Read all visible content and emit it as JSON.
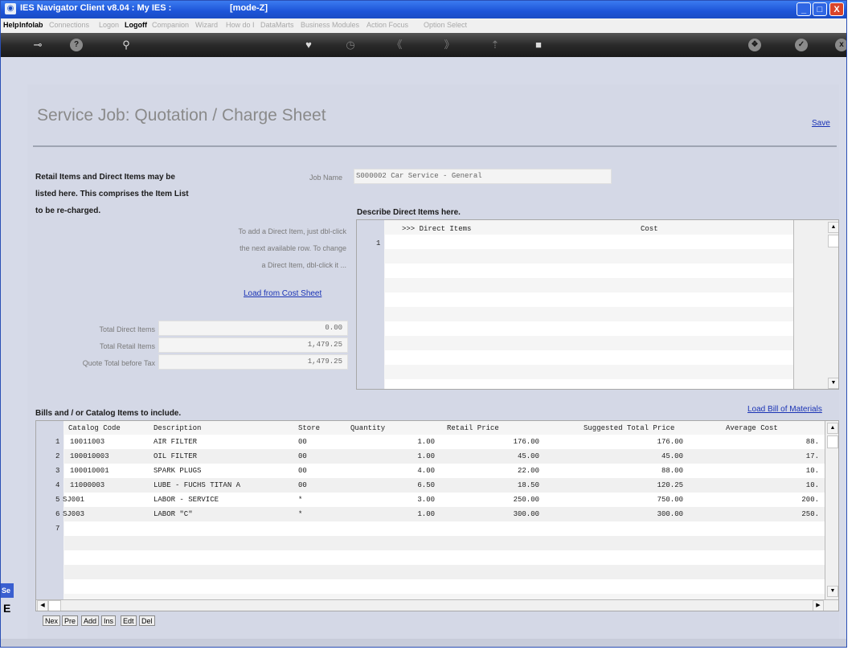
{
  "window": {
    "title": "IES Navigator Client v8.04 : My IES :",
    "mode": "[mode-Z]",
    "minimize_label": "_",
    "maximize_label": "□",
    "close_label": "X"
  },
  "menu": {
    "items": [
      {
        "label": "Help",
        "enabled": true
      },
      {
        "label": "Infolab",
        "enabled": true
      },
      {
        "label": "Connections",
        "enabled": false
      },
      {
        "label": "Logon",
        "enabled": false
      },
      {
        "label": "Logoff",
        "enabled": true
      },
      {
        "label": "Companion",
        "enabled": false
      },
      {
        "label": "Wizard",
        "enabled": false
      },
      {
        "label": "How do I",
        "enabled": false
      },
      {
        "label": "DataMarts",
        "enabled": false
      },
      {
        "label": "Business Modules",
        "enabled": false
      },
      {
        "label": "Action Focus",
        "enabled": false
      },
      {
        "label": "Option Select",
        "enabled": false
      }
    ]
  },
  "toolbar": {
    "icons": [
      "key-icon",
      "help-icon",
      "search-icon",
      "heart-icon",
      "clock-icon",
      "back-icon",
      "forward-icon",
      "up-icon",
      "stop-icon",
      "settings-icon",
      "check-icon",
      "close-icon"
    ],
    "glyphs": [
      "⊸",
      "?",
      "⚲",
      "♥",
      "◷",
      "《",
      "》",
      "⇡",
      "■",
      "❖",
      "✓",
      "x"
    ]
  },
  "page": {
    "title": "Service Job: Quotation / Charge Sheet",
    "save_link": "Save"
  },
  "intro": {
    "line1": "Retail Items and Direct Items may be",
    "line2": "listed here. This comprises the Item List",
    "line3": "to be re-charged."
  },
  "hint": {
    "line1": "To add a Direct Item, just dbl-click",
    "line2": "the next available row. To change",
    "line3": "a Direct Item, dbl-click it ..."
  },
  "job": {
    "label": "Job Name",
    "value": "S000002 Car Service - General"
  },
  "direct_items": {
    "heading": "Describe Direct Items here.",
    "col_item": ">>> Direct Items",
    "col_cost": "Cost",
    "row_numbers": [
      "1"
    ]
  },
  "load_cost_sheet": "Load from Cost Sheet",
  "totals": [
    {
      "label": "Total Direct Items",
      "value": "0.00"
    },
    {
      "label": "Total Retail Items",
      "value": "1,479.25"
    },
    {
      "label": "Quote Total before Tax",
      "value": "1,479.25"
    }
  ],
  "bills": {
    "heading": "Bills and / or Catalog Items to include.",
    "load_bom": "Load Bill of Materials",
    "columns": [
      "Catalog Code",
      "Description",
      "Store",
      "Quantity",
      "Retail Price",
      "Suggested Total Price",
      "Average Cost"
    ],
    "rows": [
      {
        "n": "1",
        "code": "10011003",
        "desc": "AIR FILTER",
        "store": "00",
        "qty": "1.00",
        "price": "176.00",
        "total": "176.00",
        "avg": "88."
      },
      {
        "n": "2",
        "code": "100010003",
        "desc": "OIL FILTER",
        "store": "00",
        "qty": "1.00",
        "price": "45.00",
        "total": "45.00",
        "avg": "17."
      },
      {
        "n": "3",
        "code": "100010001",
        "desc": "SPARK PLUGS",
        "store": "00",
        "qty": "4.00",
        "price": "22.00",
        "total": "88.00",
        "avg": "10."
      },
      {
        "n": "4",
        "code": "11000003",
        "desc": "LUBE - FUCHS TITAN A",
        "store": "00",
        "qty": "6.50",
        "price": "18.50",
        "total": "120.25",
        "avg": "10."
      },
      {
        "n": "5",
        "code": "SJ001",
        "desc": "LABOR - SERVICE",
        "store": "*",
        "qty": "3.00",
        "price": "250.00",
        "total": "750.00",
        "avg": "200."
      },
      {
        "n": "6",
        "code": "SJ003",
        "desc": "LABOR \"C\"",
        "store": "*",
        "qty": "1.00",
        "price": "300.00",
        "total": "300.00",
        "avg": "250."
      },
      {
        "n": "7",
        "code": "",
        "desc": "",
        "store": "",
        "qty": "",
        "price": "",
        "total": "",
        "avg": ""
      }
    ]
  },
  "row_buttons": [
    "Nex",
    "Pre",
    "Add",
    "Ins",
    "Edt",
    "Del"
  ],
  "side_tab": {
    "label1": "Se",
    "label2": "E"
  }
}
